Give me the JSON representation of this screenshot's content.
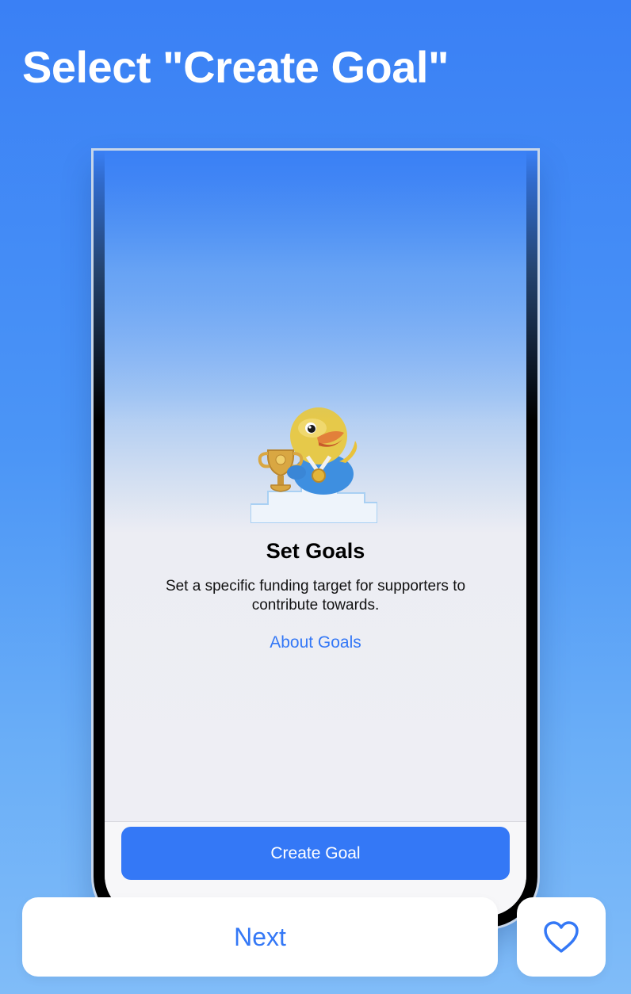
{
  "header": {
    "title": "Select \"Create Goal\""
  },
  "screen": {
    "title": "Set Goals",
    "description": "Set a specific funding target for supporters to contribute towards.",
    "about_link": "About Goals",
    "create_button_label": "Create Goal",
    "mascot_icon": "duck-trophy-icon"
  },
  "footer": {
    "next_label": "Next",
    "favorite_icon": "heart-icon"
  },
  "colors": {
    "accent": "#3478f6",
    "background_top": "#3a80f5",
    "background_bottom": "#80bcf8"
  }
}
